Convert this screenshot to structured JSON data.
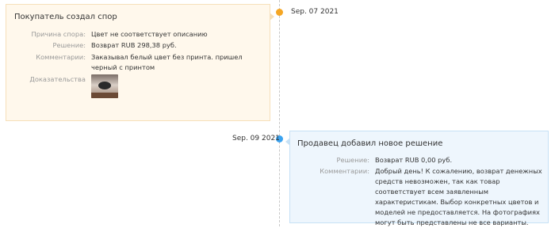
{
  "buyer_event": {
    "title": "Покупатель создал спор",
    "date": "Sep. 07 2021",
    "reason_label": "Причина спора:",
    "reason_value": "Цвет не соответствует описанию",
    "solution_label": "Решение:",
    "solution_value": "Возврат RUB 298,38 руб.",
    "comment_label": "Комментарии:",
    "comment_value": "Заказывал белый цвет без принта. пришел черный с принтом",
    "evidence_label": "Доказательства"
  },
  "seller_event": {
    "title": "Продавец добавил новое решение",
    "date": "Sep. 09 2021",
    "solution_label": "Решение:",
    "solution_value": "Возврат RUB 0,00 руб.",
    "comment_label": "Комментарии:",
    "comment_value": "Добрый день! К сожалению, возврат денежных средств невозможен, так как товар соответствует всем заявленным характеристикам. Выбор конкретных цветов и моделей не предоставляется. На фотографиях могут быть представлены не все варианты."
  },
  "colors": {
    "buyer_accent": "#f5a623",
    "seller_accent": "#3ba3f0",
    "buyer_bg": "#fff8ec",
    "seller_bg": "#eef6fd"
  }
}
